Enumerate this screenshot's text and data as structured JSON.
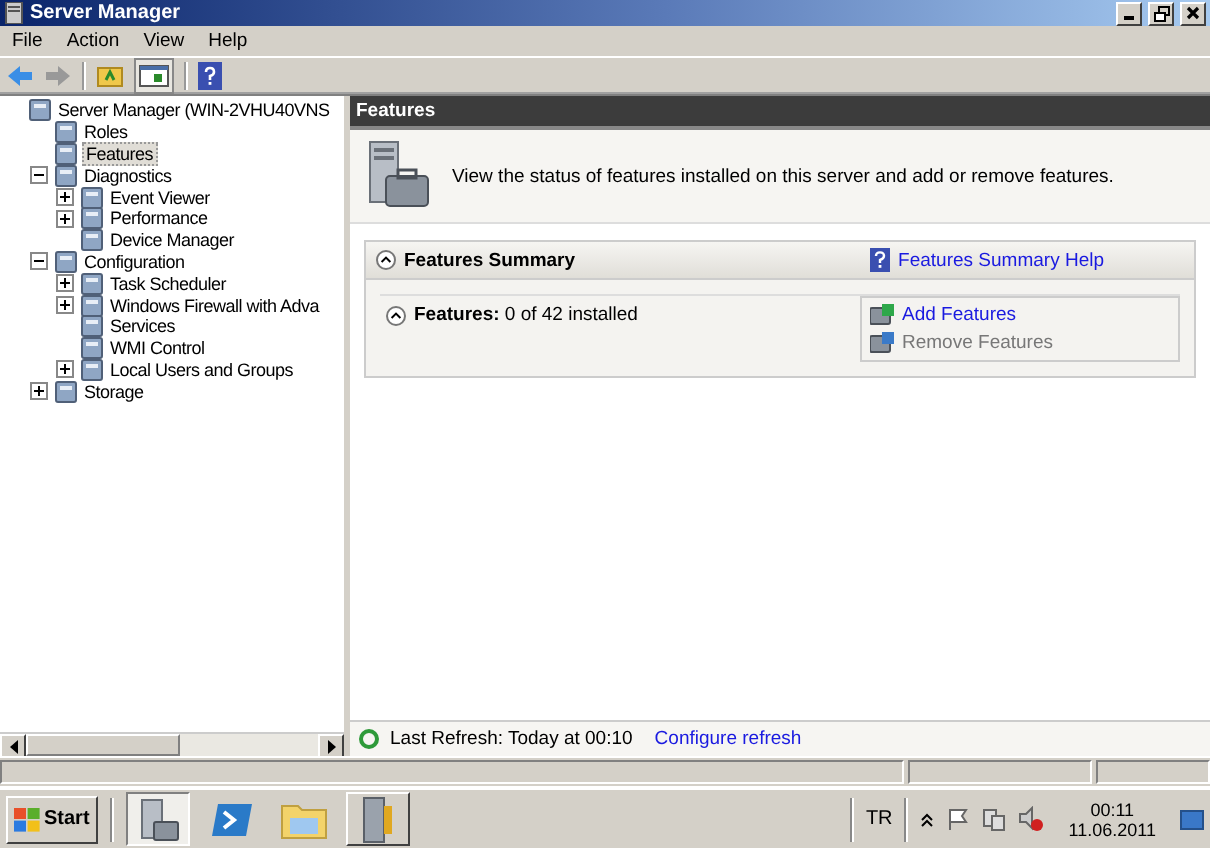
{
  "window": {
    "title": "Server Manager"
  },
  "menu": [
    "File",
    "Action",
    "View",
    "Help"
  ],
  "tree": [
    {
      "label": "Server Manager (WIN-2VHU40VNS",
      "selected": false,
      "children": [
        {
          "label": "Roles",
          "selected": false
        },
        {
          "label": "Features",
          "selected": true
        },
        {
          "label": "Diagnostics",
          "selected": false,
          "expanded": true,
          "children": [
            {
              "label": "Event Viewer",
              "selected": false,
              "expanded": false
            },
            {
              "label": "Performance",
              "selected": false,
              "expanded": false
            },
            {
              "label": "Device Manager",
              "selected": false
            }
          ]
        },
        {
          "label": "Configuration",
          "selected": false,
          "expanded": true,
          "children": [
            {
              "label": "Task Scheduler",
              "selected": false,
              "expanded": false
            },
            {
              "label": "Windows Firewall with Adva",
              "selected": false,
              "expanded": false
            },
            {
              "label": "Services",
              "selected": false
            },
            {
              "label": "WMI Control",
              "selected": false
            },
            {
              "label": "Local Users and Groups",
              "selected": false,
              "expanded": false
            }
          ]
        },
        {
          "label": "Storage",
          "selected": false,
          "expanded": false
        }
      ]
    }
  ],
  "content": {
    "header": "Features",
    "description": "View the status of features installed on this server and add or remove features.",
    "summary": {
      "title": "Features Summary",
      "help_link": "Features Summary Help",
      "features": "**Features:** 0 of 42 installed",
      "actions": [
        {
          "label": "Add Features",
          "disabled": false
        },
        {
          "label": "Remove Features",
          "disabled": true
        }
      ]
    },
    "refresh": {
      "text": "Last Refresh: Today at 00:10",
      "link": "Configure refresh"
    }
  },
  "taskbar": {
    "start": "Start",
    "language": "TR",
    "time": "00:11",
    "date": "11.06.2011"
  }
}
